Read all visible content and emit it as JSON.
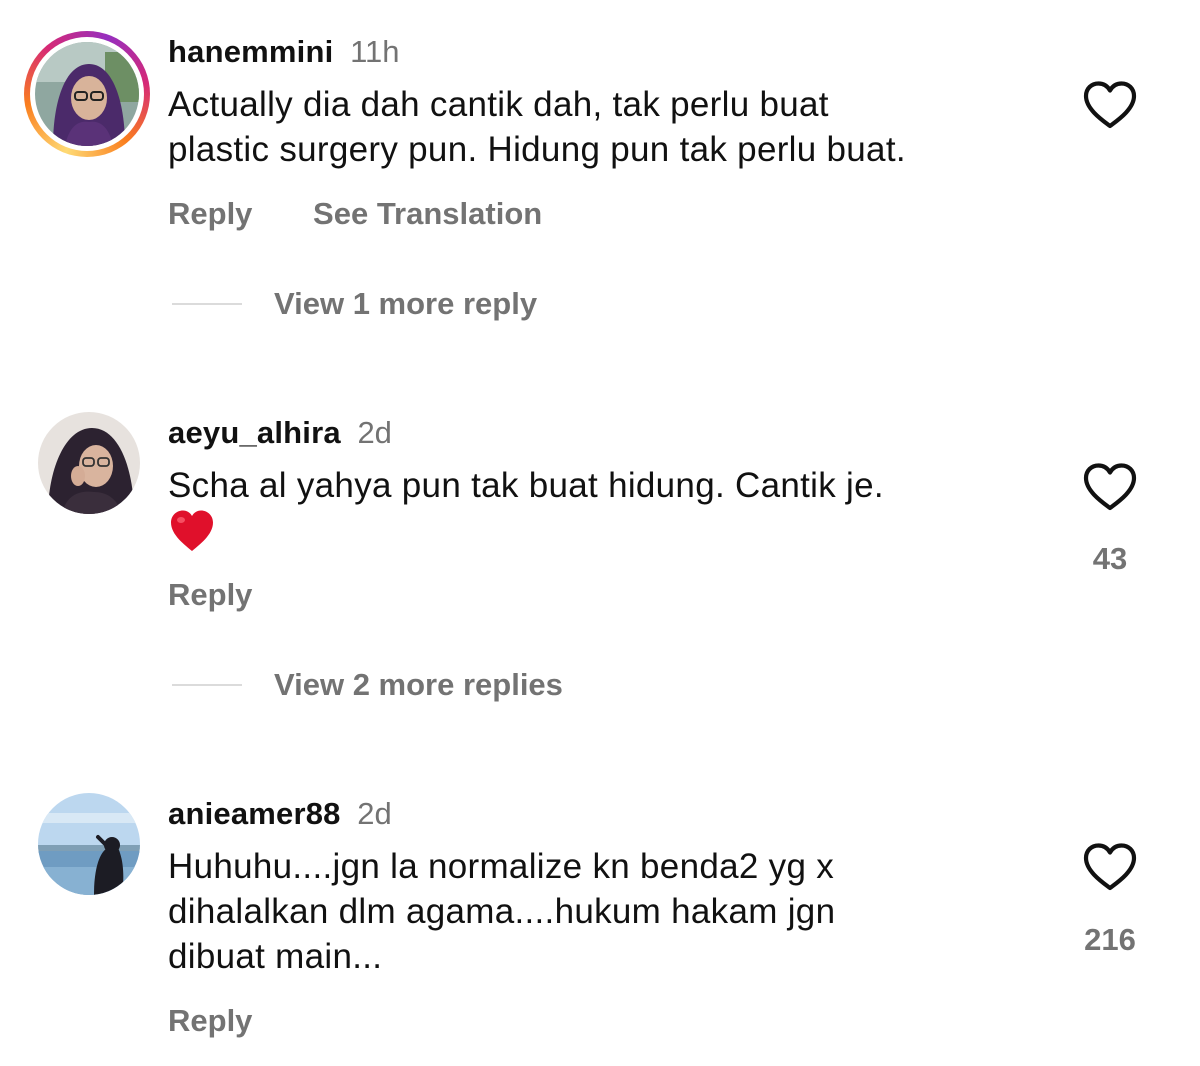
{
  "comments": [
    {
      "username": "hanemmini",
      "time": "11h",
      "text_lines": [
        "Actually dia dah cantik dah, tak perlu buat",
        "plastic surgery pun. Hidung pun tak perlu buat."
      ],
      "reply_label": "Reply",
      "translation_label": "See Translation",
      "view_replies_label": "View 1 more reply",
      "like_count": "",
      "has_story_ring": true
    },
    {
      "username": "aeyu_alhira",
      "time": "2d",
      "text_lines": [
        "Scha al yahya pun tak buat hidung. Cantik je."
      ],
      "emoji": "red-heart",
      "reply_label": "Reply",
      "view_replies_label": "View 2 more replies",
      "like_count": "43",
      "has_story_ring": false
    },
    {
      "username": "anieamer88",
      "time": "2d",
      "text_lines": [
        "Huhuhu....jgn la normalize kn benda2 yg x",
        "dihalalkan dlm agama....hukum hakam jgn",
        "dibuat main..."
      ],
      "reply_label": "Reply",
      "like_count": "216",
      "has_story_ring": false
    }
  ],
  "icons": {
    "like": "heart-outline-icon",
    "emoji": "red-heart-emoji"
  },
  "colors": {
    "secondary_text": "#737373",
    "primary_text": "#111111",
    "emoji_red": "#e0102b",
    "divider": "#dbdbdb"
  }
}
